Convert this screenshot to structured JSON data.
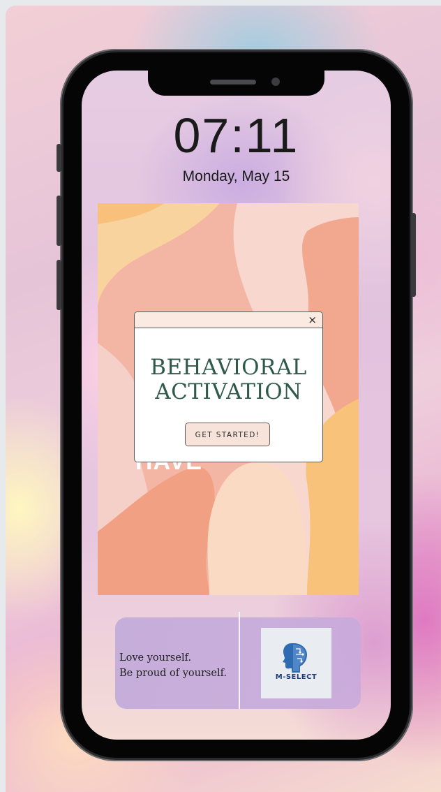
{
  "lockscreen": {
    "time": "07:11",
    "date": "Monday, May 15"
  },
  "wallpaper": {
    "partial_text": "HAVE"
  },
  "popup": {
    "close_glyph": "×",
    "title_line1": "BEHAVIORAL",
    "title_line2": "ACTIVATION",
    "button_label": "GET STARTED!"
  },
  "widget": {
    "quote_line1": "Love yourself.",
    "quote_line2": "Be proud of yourself.",
    "logo_text": "M-SELECT",
    "logo_icon": "brain-head-icon"
  },
  "colors": {
    "title_green": "#2f5a4a",
    "button_bg": "#f8e3da",
    "logo_blue": "#1f3c7a"
  }
}
